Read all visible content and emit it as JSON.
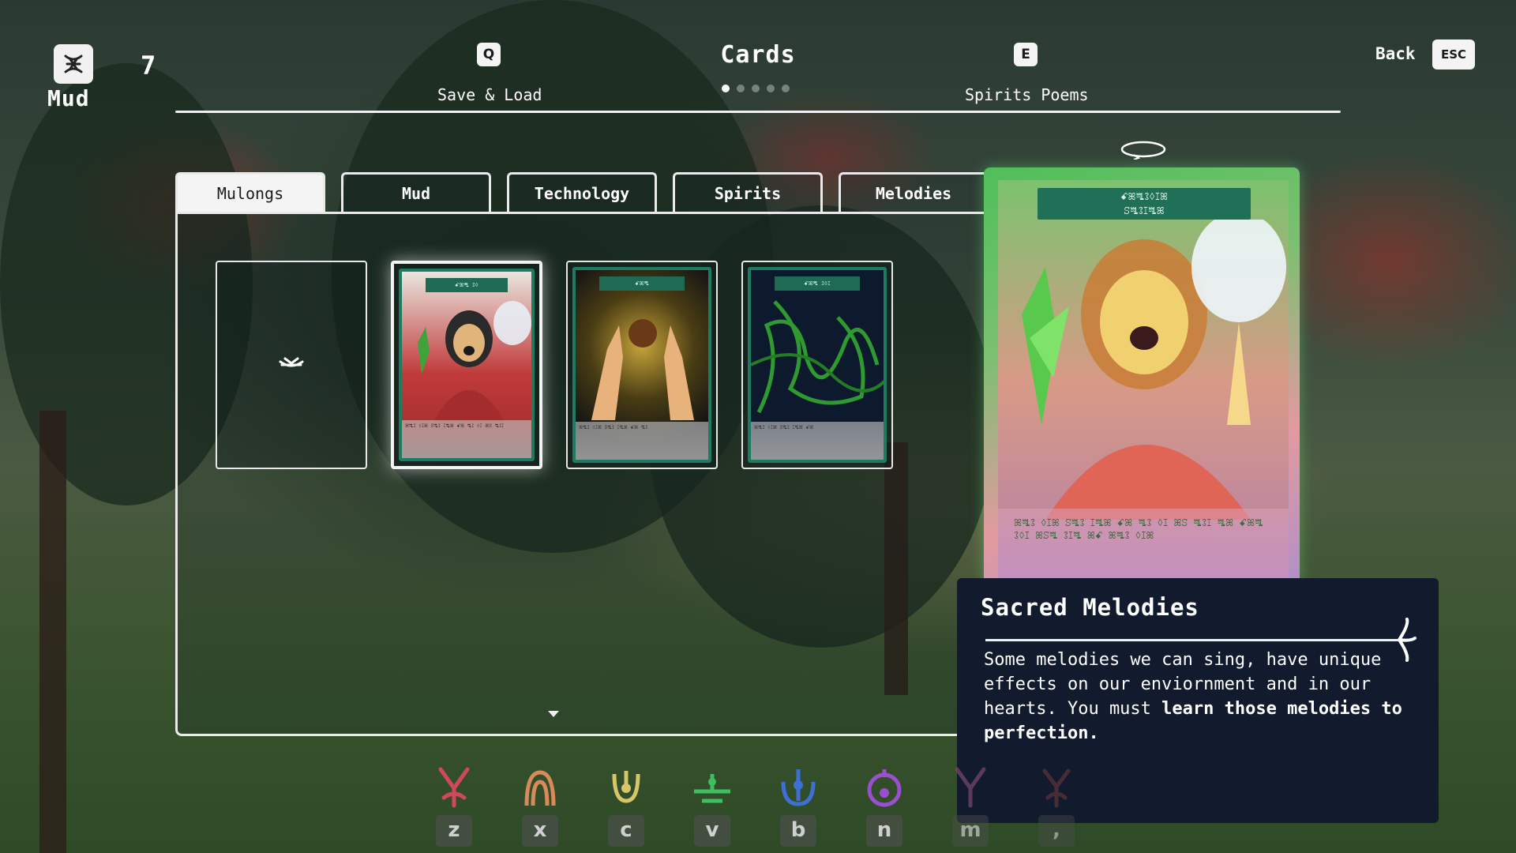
{
  "resource": {
    "label": "Mud",
    "count": "7",
    "icon": "mud-glyph-icon"
  },
  "nav": {
    "left": {
      "key": "Q",
      "label": "Save & Load"
    },
    "title": "Cards",
    "right": {
      "key": "E",
      "label": "Spirits Poems"
    },
    "back": {
      "label": "Back",
      "key": "ESC"
    },
    "page_dots": {
      "total": 5,
      "active_index": 0
    }
  },
  "tabs": [
    {
      "label": "Mulongs",
      "active": true
    },
    {
      "label": "Mud",
      "active": false
    },
    {
      "label": "Technology",
      "active": false
    },
    {
      "label": "Spirits",
      "active": false
    },
    {
      "label": "Melodies",
      "active": false
    }
  ],
  "cards": [
    {
      "kind": "empty",
      "icon": "mud-glyph-icon"
    },
    {
      "kind": "singer",
      "selected": true
    },
    {
      "kind": "hands-orb"
    },
    {
      "kind": "vines"
    }
  ],
  "detail": {
    "title": "Sacred Melodies",
    "body_1": "Some melodies we can sing, have unique effects on our enviornment and in our hearts. You must ",
    "body_bold": "learn those melodies to perfection.",
    "rune_header": "ꗃꕤꗀꕘꕺꕯꕤ\nꕶꗀꕘꕯꗀꕤ"
  },
  "hotkeys": [
    {
      "letter": "z",
      "color": "#d1485a"
    },
    {
      "letter": "x",
      "color": "#d98a5a"
    },
    {
      "letter": "c",
      "color": "#d7c56a"
    },
    {
      "letter": "v",
      "color": "#3fbf62"
    },
    {
      "letter": "b",
      "color": "#3e6fd6"
    },
    {
      "letter": "n",
      "color": "#9a4fd0"
    },
    {
      "letter": "m",
      "color": "#7a4a72"
    },
    {
      "letter": ",",
      "color": "#6a3838"
    }
  ]
}
